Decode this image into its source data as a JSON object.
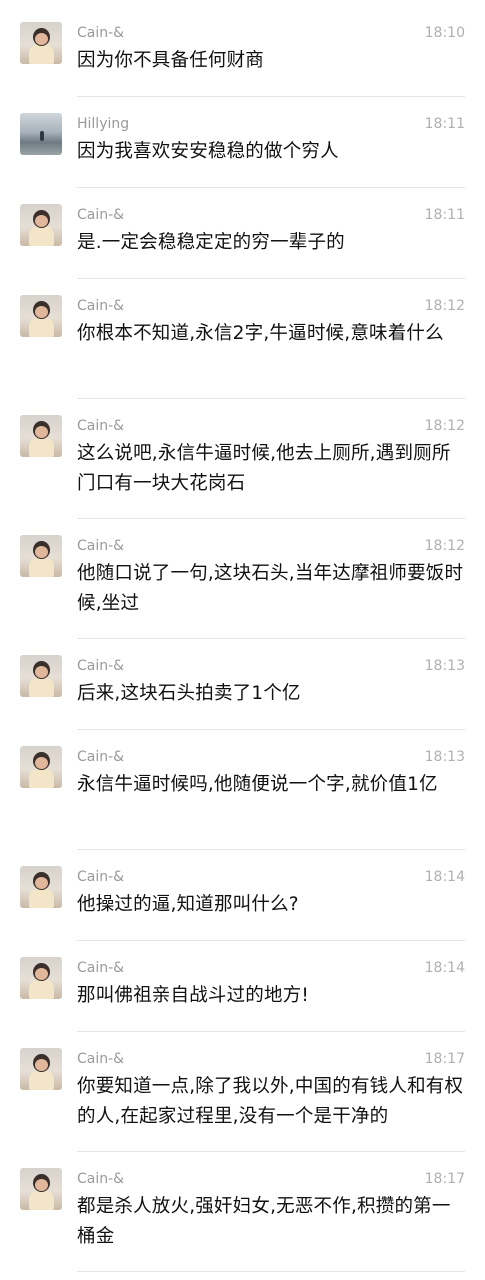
{
  "messages": [
    {
      "sender": "Cain-&",
      "time": "18:10",
      "text": "因为你不具备任何财商"
    },
    {
      "sender": "Hillying",
      "time": "18:11",
      "text": "因为我喜欢安安稳稳的做个穷人"
    },
    {
      "sender": "Cain-&",
      "time": "18:11",
      "text": "是.一定会稳稳定定的穷一辈子的"
    },
    {
      "sender": "Cain-&",
      "time": "18:12",
      "text": "你根本不知道,永信2字,牛逼时候,意味着什么"
    },
    {
      "sender": "Cain-&",
      "time": "18:12",
      "text": "这么说吧,永信牛逼时候,他去上厕所,遇到厕所门口有一块大花岗石"
    },
    {
      "sender": "Cain-&",
      "time": "18:12",
      "text": "他随口说了一句,这块石头,当年达摩祖师要饭时候,坐过"
    },
    {
      "sender": "Cain-&",
      "time": "18:13",
      "text": "后来,这块石头拍卖了1个亿"
    },
    {
      "sender": "Cain-&",
      "time": "18:13",
      "text": "永信牛逼时候吗,他随便说一个字,就价值1亿"
    },
    {
      "sender": "Cain-&",
      "time": "18:14",
      "text": "他操过的逼,知道那叫什么?"
    },
    {
      "sender": "Cain-&",
      "time": "18:14",
      "text": "那叫佛祖亲自战斗过的地方!"
    },
    {
      "sender": "Cain-&",
      "time": "18:17",
      "text": "你要知道一点,除了我以外,中国的有钱人和有权的人,在起家过程里,没有一个是干净的"
    },
    {
      "sender": "Cain-&",
      "time": "18:17",
      "text": "都是杀人放火,强奸妇女,无恶不作,积攒的第一桶金"
    }
  ]
}
